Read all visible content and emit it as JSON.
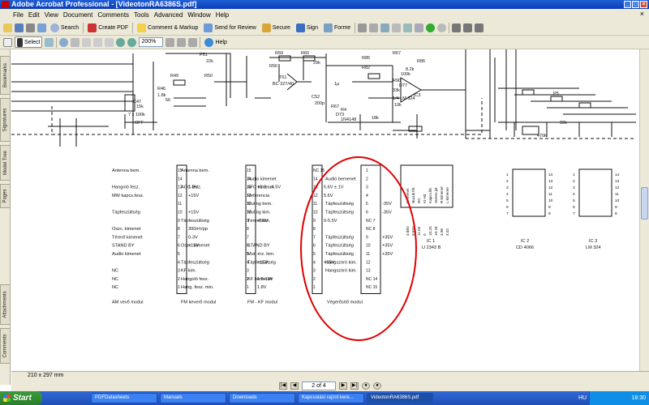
{
  "window": {
    "title": "Adobe Acrobat Professional - [VideotonRA6386S.pdf]"
  },
  "menu": [
    "File",
    "Edit",
    "View",
    "Document",
    "Comments",
    "Tools",
    "Advanced",
    "Window",
    "Help"
  ],
  "toolbar1": {
    "search": "Search",
    "create_pdf": "Create PDF",
    "comment_markup": "Comment & Markup",
    "send_review": "Send for Review",
    "secure": "Secure",
    "sign": "Sign",
    "forms": "Forme"
  },
  "toolbar2": {
    "select": "Select",
    "zoom": "200%",
    "help": "Help"
  },
  "side_tabs": [
    "Bookmarks",
    "Signatures",
    "Model Tree",
    "Pages",
    "Attachments",
    "Comments"
  ],
  "status": {
    "page_size": "210 x 297 mm",
    "page_indicator": "2 of 4"
  },
  "schematic": {
    "modules": [
      {
        "name": "AM vevő modul",
        "pins": [
          {
            "label": "Antenna bem.",
            "num": "15",
            "volt": ""
          },
          {
            "label": "",
            "num": "14",
            "volt": ""
          },
          {
            "label": "Hangoló fesz.",
            "num": "13",
            "volt": "1-9V"
          },
          {
            "label": "MW kapcs.fesz.",
            "num": "12",
            "volt": "+15V"
          },
          {
            "label": "",
            "num": "11",
            "volt": ""
          },
          {
            "label": "Tápfeszültség",
            "num": "10",
            "volt": "+15V"
          },
          {
            "label": "",
            "num": "9",
            "volt": ""
          },
          {
            "label": "Oszc. kimenet",
            "num": "8",
            "volt": "300mVpp"
          },
          {
            "label": "Térerő kimenet",
            "num": "7",
            "volt": "0-3V"
          },
          {
            "label": "STAND BY",
            "num": "6",
            "volt": "+15V"
          },
          {
            "label": "Audio kimenet",
            "num": "5",
            "volt": ""
          },
          {
            "label": "",
            "num": "4",
            "volt": ""
          },
          {
            "label": "NC",
            "num": "3",
            "volt": ""
          },
          {
            "label": "NC",
            "num": "2",
            "volt": ""
          },
          {
            "label": "NC",
            "num": "1",
            "volt": ""
          }
        ]
      },
      {
        "name": "FM keverő modul",
        "pins": [
          {
            "label": "Antenna bem.",
            "num": "15",
            "volt": ""
          },
          {
            "label": "",
            "num": "14",
            "volt": ""
          },
          {
            "label": "AGC fesz.",
            "num": "13",
            "volt": "+5.3...-4.5V"
          },
          {
            "label": "",
            "num": "12",
            "volt": ""
          },
          {
            "label": "",
            "num": "11",
            "volt": ""
          },
          {
            "label": "",
            "num": "10",
            "volt": ""
          },
          {
            "label": "Tápfeszültség",
            "num": "9",
            "volt": "+15V"
          },
          {
            "label": "",
            "num": "8",
            "volt": ""
          },
          {
            "label": "",
            "num": "7",
            "volt": ""
          },
          {
            "label": "Oszc. kimenet",
            "num": "6",
            "volt": ""
          },
          {
            "label": "",
            "num": "5",
            "volt": ""
          },
          {
            "label": "Tápfeszültség",
            "num": "4",
            "volt": "+15V"
          },
          {
            "label": "KF kim.",
            "num": "3",
            "volt": ""
          },
          {
            "label": "Hangoló fesz.",
            "num": "2",
            "volt": "1.8-13V"
          },
          {
            "label": "Hang. fesz. min.",
            "num": "1",
            "volt": "1.8V"
          }
        ]
      },
      {
        "name": "FM - KF modul",
        "pins": [
          {
            "label": "",
            "num": "NC 15",
            "volt": ""
          },
          {
            "label": "Audio kimenet",
            "num": "14",
            "volt": ""
          },
          {
            "label": "AFC kimenet",
            "num": "13",
            "volt": "5.6V ± 1V"
          },
          {
            "label": "Referencia",
            "num": "12",
            "volt": "5.6V"
          },
          {
            "label": "Muting bem.",
            "num": "11",
            "volt": ""
          },
          {
            "label": "Muting kim.",
            "num": "10",
            "volt": ""
          },
          {
            "label": "Térerő kim.",
            "num": "9",
            "volt": "0-5.5V"
          },
          {
            "label": "",
            "num": "8",
            "volt": ""
          },
          {
            "label": "",
            "num": "7",
            "volt": ""
          },
          {
            "label": "STAND BY",
            "num": "6",
            "volt": ""
          },
          {
            "label": "Mut. érz. kim.",
            "num": "5",
            "volt": ""
          },
          {
            "label": "Tápfeszültség",
            "num": "4",
            "volt": "+15V"
          },
          {
            "label": "",
            "num": "3",
            "volt": ""
          },
          {
            "label": "KF bemenet",
            "num": "2",
            "volt": ""
          },
          {
            "label": "",
            "num": "1",
            "volt": ""
          }
        ]
      },
      {
        "name": "Végerősítő modul",
        "pins": [
          {
            "label": "",
            "num": "1",
            "volt": ""
          },
          {
            "label": "Audió bemenet",
            "num": "2",
            "volt": ""
          },
          {
            "label": "",
            "num": "3",
            "volt": ""
          },
          {
            "label": "",
            "num": "4",
            "volt": ""
          },
          {
            "label": "Tápfeszültség",
            "num": "5",
            "volt": "-35V"
          },
          {
            "label": "Tápfeszültség",
            "num": "6",
            "volt": "-35V"
          },
          {
            "label": "",
            "num": "NC 7",
            "volt": ""
          },
          {
            "label": "",
            "num": "NC 8",
            "volt": ""
          },
          {
            "label": "Tápfeszültség",
            "num": "9",
            "volt": "+35V"
          },
          {
            "label": "Tápfeszültség",
            "num": "10",
            "volt": "+35V"
          },
          {
            "label": "Tápfeszültség",
            "num": "11",
            "volt": "+35V"
          },
          {
            "label": "Hangszóró kim.",
            "num": "12",
            "volt": ""
          },
          {
            "label": "Hangszóró kim.",
            "num": "13",
            "volt": ""
          },
          {
            "label": "",
            "num": "NC 14",
            "volt": ""
          },
          {
            "label": "",
            "num": "NC 15",
            "volt": ""
          }
        ]
      }
    ],
    "ic1": {
      "name": "IC 1",
      "part": "U 2343 B",
      "pin_labels": [
        "Bemenet",
        "Nucuk filt.",
        "RC",
        "Ki Hd",
        "Kapcs.filt.",
        "Stereo jel",
        "R kimenet",
        "L kimenet"
      ],
      "voltages": [
        "3.88V",
        "9.63V",
        "11.00",
        "0",
        "10.25",
        "10.28",
        "3.98",
        "4.02"
      ]
    },
    "ic2": {
      "name": "IC 2",
      "part": "CD 4066"
    },
    "ic3": {
      "name": "IC 3",
      "part": "LM 324"
    },
    "components": [
      "R59",
      "R60",
      "29k",
      "R56",
      "T61",
      "BC 327/40",
      "C52",
      "200p",
      "R67",
      "R4",
      "R67",
      "R86",
      "R85",
      "R82",
      "R90",
      "D77",
      "D73",
      "1N4148",
      "IC3",
      "1/4 LM 324",
      "P51",
      "22k",
      "R49",
      "R50",
      "C47",
      "R46",
      "1.8k",
      "56",
      "7 x 100k",
      "OFF",
      "P5",
      "22k",
      "470k",
      "100k",
      "33k",
      "8.2k",
      "10k",
      "1µ",
      "15k",
      "18k"
    ]
  },
  "taskbar": {
    "start": "Start",
    "items": [
      "PDFDatasheets",
      "Manuals",
      "Downloads",
      "Kapcsolási rajzot kere...",
      "VideotonRA6386S.pdf"
    ],
    "lang": "HU",
    "clock": "18:30"
  },
  "colors": {
    "titlebar": "#0a3db8",
    "chrome": "#ece9d8",
    "highlight": "#e00000",
    "taskbar": "#245edb"
  }
}
